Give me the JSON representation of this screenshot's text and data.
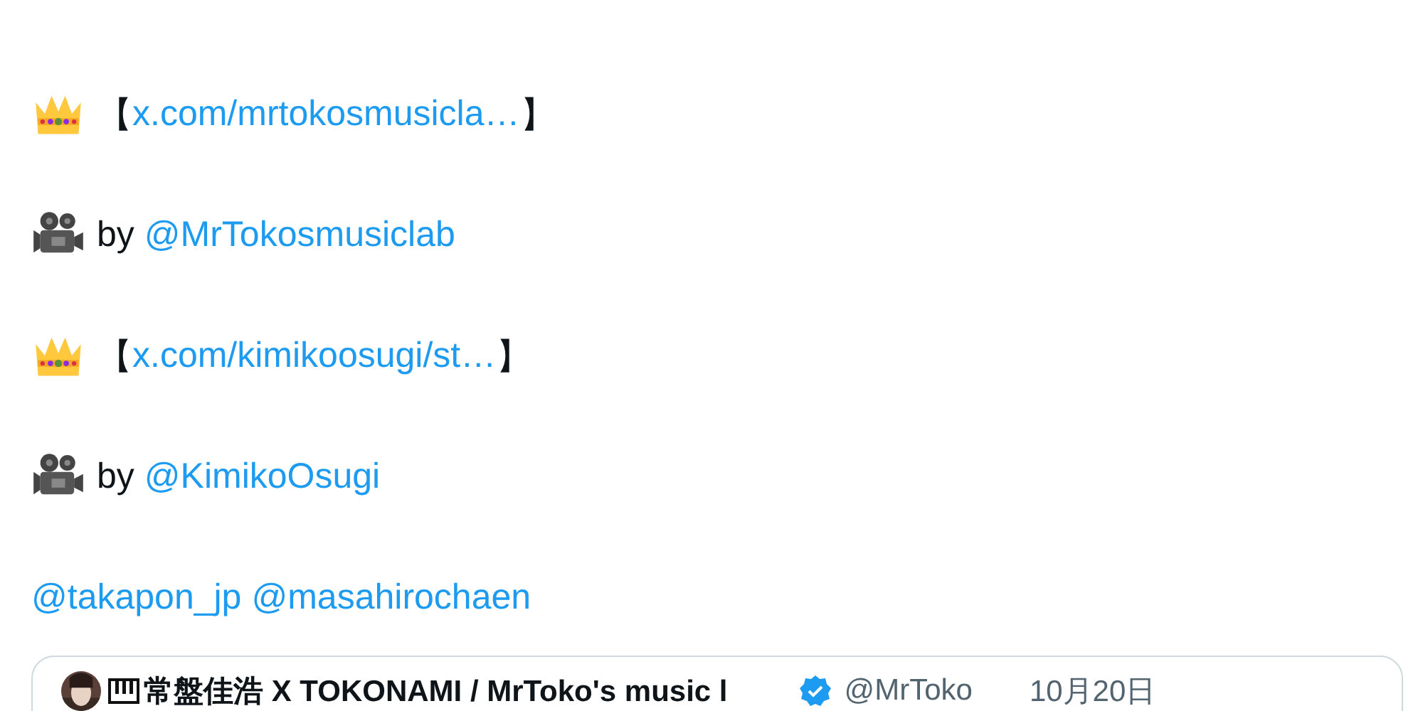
{
  "lines": [
    {
      "kind": "crown_link",
      "open": "【",
      "link": "x.com/mrtokosmusicla…",
      "close": "】"
    },
    {
      "kind": "camera_credit",
      "text": "by",
      "link": "@MrTokosmusiclab"
    },
    {
      "kind": "crown_link",
      "open": "【",
      "link": "x.com/kimikoosugi/st…",
      "close": "】"
    },
    {
      "kind": "camera_credit",
      "text": "by",
      "link": "@KimikoOsugi"
    }
  ],
  "mentions": [
    "@takapon_jp",
    "@masahirochaen"
  ],
  "quote": {
    "name": "常盤佳浩 X TOKONAMI / MrToko's music l",
    "verified": true,
    "handle": "@MrToko",
    "date": "10月20日"
  }
}
